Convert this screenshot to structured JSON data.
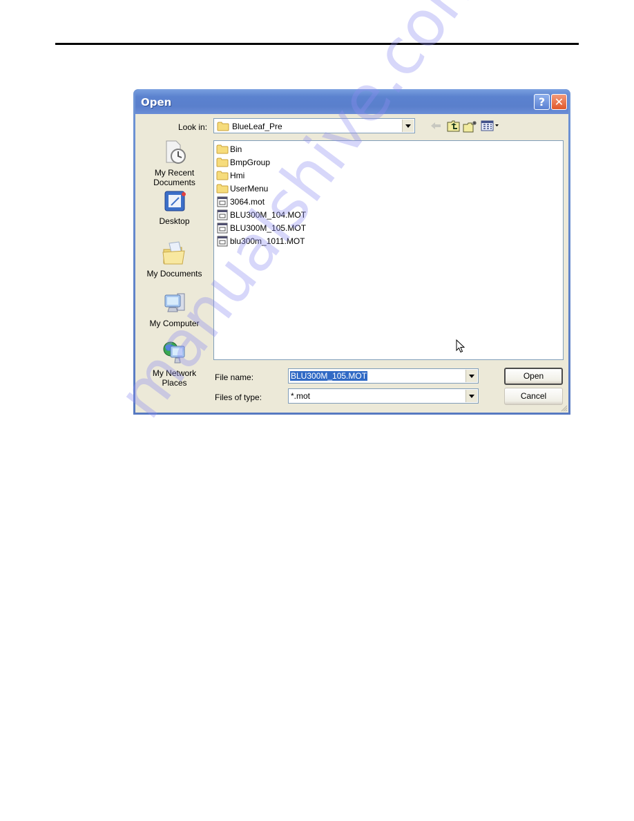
{
  "document": {
    "watermark": "manualshive.com"
  },
  "dialog": {
    "title": "Open",
    "help_button": "?",
    "close_button": "✕",
    "look_in": {
      "label": "Look in:",
      "value": "BlueLeaf_Pre"
    },
    "toolbar": {
      "back": "back-icon",
      "up_one_level": "up-folder-icon",
      "new_folder": "new-folder-icon",
      "views": "views-menu-icon"
    },
    "places": [
      {
        "label": "My Recent Documents",
        "line1": "My Recent",
        "line2": "Documents",
        "icon": "recent-documents-icon"
      },
      {
        "label": "Desktop",
        "line1": "Desktop",
        "line2": "",
        "icon": "desktop-icon"
      },
      {
        "label": "My Documents",
        "line1": "My Documents",
        "line2": "",
        "icon": "my-documents-icon"
      },
      {
        "label": "My Computer",
        "line1": "My Computer",
        "line2": "",
        "icon": "my-computer-icon"
      },
      {
        "label": "My Network Places",
        "line1": "My Network",
        "line2": "Places",
        "icon": "network-places-icon"
      }
    ],
    "files": [
      {
        "name": "Bin",
        "type": "folder"
      },
      {
        "name": "BmpGroup",
        "type": "folder"
      },
      {
        "name": "Hmi",
        "type": "folder"
      },
      {
        "name": "UserMenu",
        "type": "folder"
      },
      {
        "name": "3064.mot",
        "type": "file"
      },
      {
        "name": "BLU300M_104.MOT",
        "type": "file"
      },
      {
        "name": "BLU300M_105.MOT",
        "type": "file"
      },
      {
        "name": "blu300m_1011.MOT",
        "type": "file"
      }
    ],
    "file_name": {
      "label": "File name:",
      "value": "BLU300M_105.MOT"
    },
    "file_type": {
      "label": "Files of type:",
      "value": "*.mot"
    },
    "buttons": {
      "open": "Open",
      "cancel": "Cancel"
    }
  }
}
